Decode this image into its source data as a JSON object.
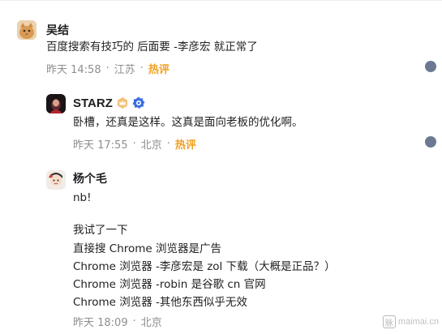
{
  "comments": [
    {
      "username": "吴结",
      "avatar_icon": "cat-avatar-icon",
      "text": "百度搜索有技巧的 后面要 -李彦宏 就正常了",
      "time": "昨天 14:58",
      "location": "江苏",
      "tag": "热评"
    },
    {
      "username": "STARZ",
      "avatar_icon": "dark-avatar-icon",
      "badges": [
        "crown-badge-icon",
        "verified-gear-icon"
      ],
      "text": "卧槽，还真是这样。这真是面向老板的优化啊。",
      "time": "昨天 17:55",
      "location": "北京",
      "tag": "热评"
    },
    {
      "username": "杨个毛",
      "avatar_icon": "character-avatar-icon",
      "lines": [
        "nb!",
        "我试了一下",
        "直接搜 Chrome 浏览器是广告",
        "Chrome 浏览器 -李彦宏是 zol 下载（大概是正品？）",
        "Chrome 浏览器 -robin 是谷歌 cn 官网",
        "Chrome 浏览器 -其他东西似乎无效"
      ],
      "time": "昨天 18:09",
      "location": "北京"
    }
  ],
  "separator": "·",
  "watermark": {
    "icon_char": "脉",
    "text": "maimai.cn"
  },
  "colors": {
    "hot": "#f0a020",
    "meta": "#8e8e8e",
    "reply_dot": "#6b7a92"
  }
}
